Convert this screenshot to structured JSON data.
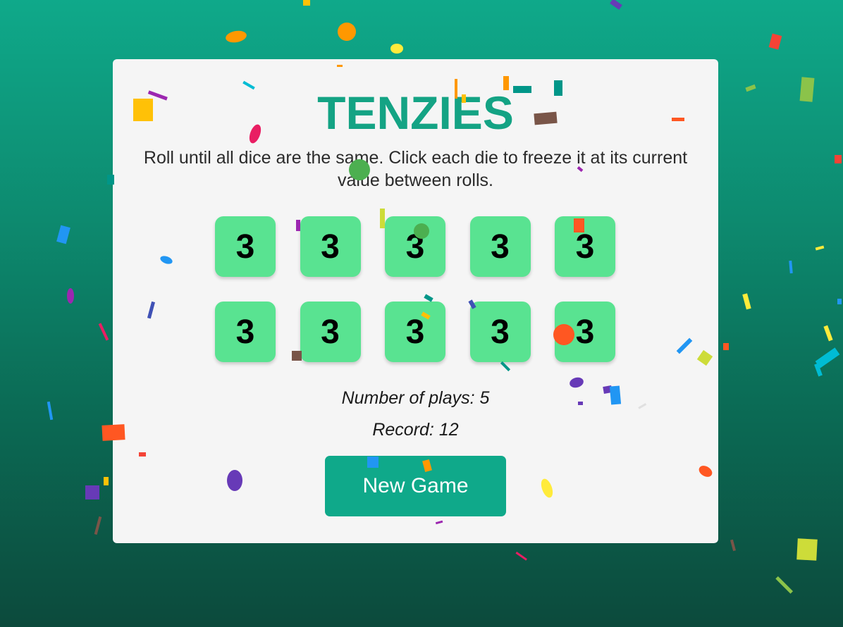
{
  "game": {
    "title": "TENZIES",
    "instructions": "Roll until all dice are the same. Click each die to freeze it at its current value between rolls.",
    "dice": [
      "3",
      "3",
      "3",
      "3",
      "3",
      "3",
      "3",
      "3",
      "3",
      "3"
    ],
    "plays_label": "Number of plays: 5",
    "record_label": "Record: 12",
    "button_label": "New Game"
  },
  "colors": {
    "accent": "#14a384",
    "die_held": "#59e391",
    "card_bg": "#f5f5f5",
    "button_bg": "#0fa98a"
  },
  "effects": {
    "confetti": true
  }
}
